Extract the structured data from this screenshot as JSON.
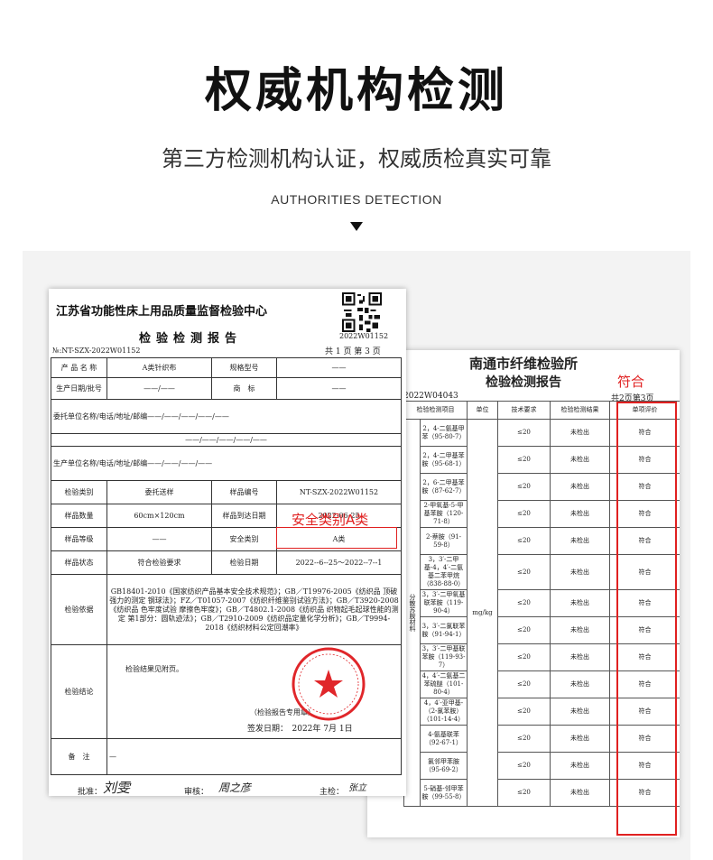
{
  "hero": {
    "title": "权威机构检测",
    "subtitle": "第三方检测机构认证，权威质检真实可靠",
    "english": "AUTHORITIES DETECTION"
  },
  "colors": {
    "highlight_red": "#e02020",
    "panel_bg": "#f3f3f3"
  },
  "report_left": {
    "org": "江苏省功能性床上用品质量监督检验中心",
    "title": "检验检测报告",
    "qr_code_text": "2022W01152",
    "report_no": "№:NT-SZX-2022W01152",
    "page": "共 1 页  第 3 页",
    "rows": {
      "product_name_label": "产 品 名 称",
      "product_name_value": "A类针织布",
      "spec_label": "规格型号",
      "spec_value": "——",
      "date_label": "生产日期/批号",
      "date_value": "——/——",
      "brand_label": "商　标",
      "brand_value": "——",
      "client_label": "委托单位名称/电话/地址/邮编",
      "client_value": "——/——/——/——/——",
      "mid_value": "——/——/——/——/——",
      "maker_label": "生产单位名称/电话/地址/邮编",
      "maker_value": "——/——/——/——",
      "type_label": "检验类别",
      "type_value": "委托送样",
      "sample_no_label": "样品编号",
      "sample_no_value": "NT-SZX-2022W01152",
      "qty_label": "样品数量",
      "qty_value": "60cm×120cm",
      "arrival_label": "样品到达日期",
      "arrival_value": "2022-06-25",
      "grade_label": "样品等级",
      "grade_value": "——",
      "safety_label": "安全类别",
      "safety_value": "A类",
      "state_label": "样品状态",
      "state_value": "符合检验要求",
      "test_date_label": "检验日期",
      "test_date_value": "2022--6--25～2022--7--1",
      "basis_label": "检验依据",
      "basis_value": "GB18401-2010《国家纺织产品基本安全技术规范》；GB／T19976-2005《纺织品 顶破强力的测定 钢球法》；FZ／T01057-2007《纺织纤维鉴别试验方法》；GB／T3920-2008《纺织品 色牢度试验 摩擦色牢度》；GB／T4802.1-2008《纺织品 织物起毛起球性能的测定 第1部分：圆轨迹法》；GB／T2910-2009《纺织品定量化学分析》；GB／T9994-2018《纺织材料公定回潮率》",
      "conclusion_label": "检验结论",
      "conclusion_value": "检验结果见附页。",
      "seal_note": "（检验报告专用章）",
      "issue_date": "签发日期：　2022年 7月 1日",
      "remark_label": "备　注",
      "remark_value": "—"
    },
    "signers": {
      "approve_label": "批准：",
      "approve_sig": "刘雯",
      "review_label": "审核：",
      "review_sig": "周之彦",
      "inspect_label": "主检：",
      "inspect_sig": "张立"
    }
  },
  "report_right": {
    "org": "南通市纤维检验所",
    "title": "检验检测报告",
    "report_no": "2022W04043",
    "page": "共2页第3页",
    "headers": [
      "检验检测项目",
      "单位",
      "技术要求",
      "检验检测结果",
      "单项评价"
    ],
    "side_label": "分散苏胺材料",
    "unit": "mg/kg",
    "items": [
      {
        "name": "2，4-二氨基甲苯（95-80-7）",
        "req": "≤20",
        "result": "未检出",
        "eval": "符合"
      },
      {
        "name": "2，4-二甲基苯胺（95-68-1）",
        "req": "≤20",
        "result": "未检出",
        "eval": "符合"
      },
      {
        "name": "2，6-二甲基苯胺（87-62-7）",
        "req": "≤20",
        "result": "未检出",
        "eval": "符合"
      },
      {
        "name": "2-甲氧基-5-甲基苯胺（120-71-8）",
        "req": "≤20",
        "result": "未检出",
        "eval": "符合"
      },
      {
        "name": "2-萘胺（91-59-8）",
        "req": "≤20",
        "result": "未检出",
        "eval": "符合"
      },
      {
        "name": "3，3′-二甲基-4，4′-二氨基二苯甲烷（838-88-0）",
        "req": "≤20",
        "result": "未检出",
        "eval": "符合"
      },
      {
        "name": "3，3′-二甲氧基联苯胺（119-90-4）",
        "req": "≤20",
        "result": "未检出",
        "eval": "符合"
      },
      {
        "name": "3，3′-二氯联苯胺（91-94-1）",
        "req": "≤20",
        "result": "未检出",
        "eval": "符合"
      },
      {
        "name": "3，3′-二甲基联苯胺（119-93-7）",
        "req": "≤20",
        "result": "未检出",
        "eval": "符合"
      },
      {
        "name": "4，4′-二氨基二苯硫醚（101-80-4）",
        "req": "≤20",
        "result": "未检出",
        "eval": "符合"
      },
      {
        "name": "4，4′-亚甲基-（2-氯苯胺）（101-14-4）",
        "req": "≤20",
        "result": "未检出",
        "eval": "符合"
      },
      {
        "name": "4-氨基联苯（92-67-1）",
        "req": "≤20",
        "result": "未检出",
        "eval": "符合"
      },
      {
        "name": "氯邻甲苯胺（95-69-2）",
        "req": "≤20",
        "result": "未检出",
        "eval": "符合"
      },
      {
        "name": "5-硝基-邻甲苯胺（99-55-8）",
        "req": "≤20",
        "result": "未检出",
        "eval": "符合"
      }
    ]
  },
  "annotations": {
    "left_label": "安全类别A类",
    "right_label": "符合"
  }
}
